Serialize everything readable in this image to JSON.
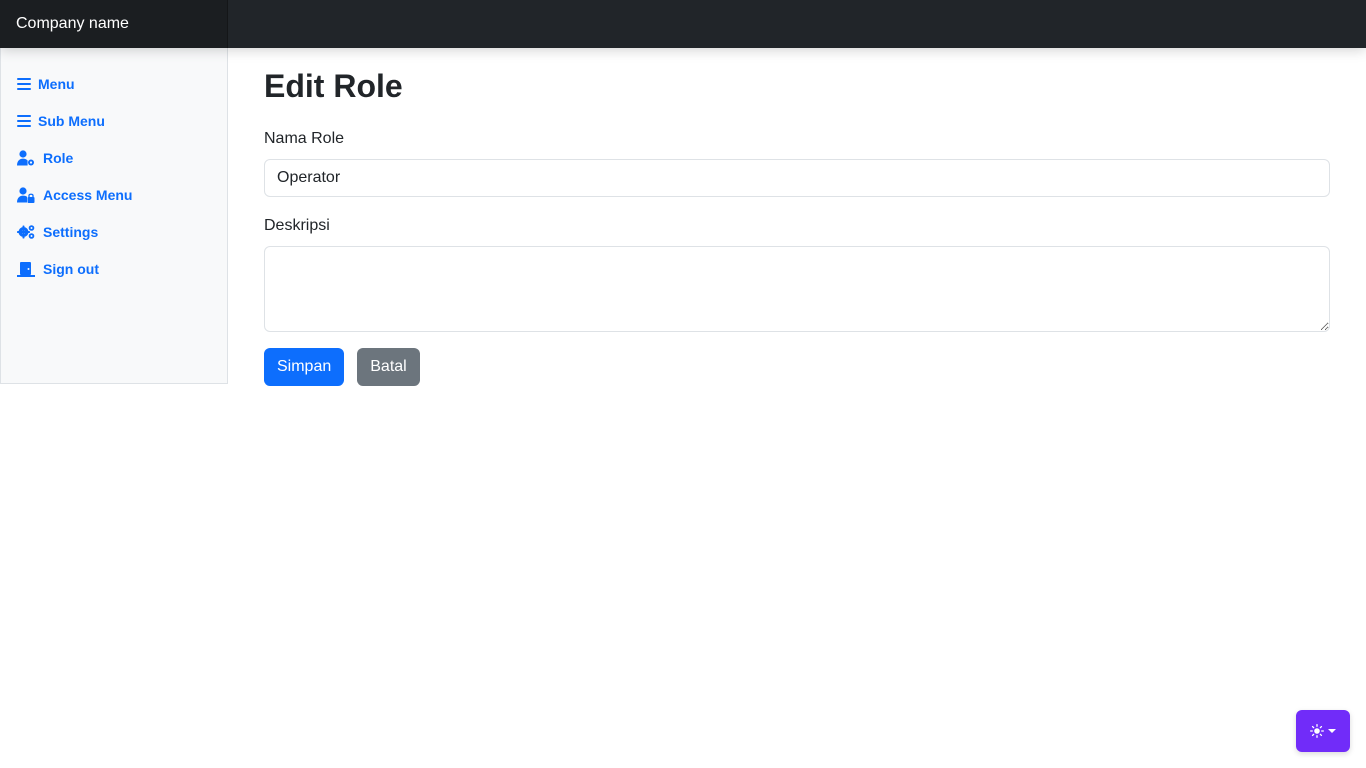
{
  "header": {
    "brand": "Company name"
  },
  "sidebar": {
    "items": [
      {
        "label": "Menu",
        "icon": "bars-icon"
      },
      {
        "label": "Sub Menu",
        "icon": "bars-icon"
      },
      {
        "label": "Role",
        "icon": "user-gear-icon"
      },
      {
        "label": "Access Menu",
        "icon": "user-lock-icon"
      },
      {
        "label": "Settings",
        "icon": "gears-icon"
      },
      {
        "label": "Sign out",
        "icon": "door-icon"
      }
    ]
  },
  "main": {
    "title": "Edit Role",
    "fields": {
      "role_name": {
        "label": "Nama Role",
        "value": "Operator"
      },
      "description": {
        "label": "Deskripsi",
        "value": ""
      }
    },
    "buttons": {
      "save": "Simpan",
      "cancel": "Batal"
    }
  },
  "theme_toggle": {
    "icon": "sun-icon"
  },
  "colors": {
    "primary": "#0d6efd",
    "secondary": "#6c757d",
    "topbar": "#212529",
    "theme_toggle": "#712cf9"
  }
}
